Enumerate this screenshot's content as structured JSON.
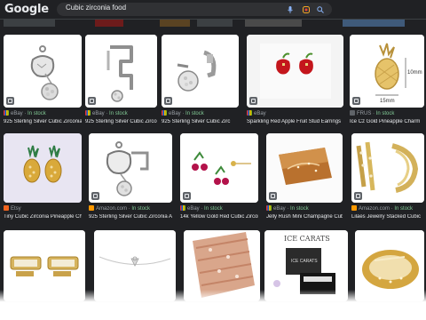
{
  "header": {
    "logo": "Google",
    "query": "Cubic zirconia food"
  },
  "icons": {
    "mic": "microphone-icon",
    "lens": "google-lens-icon",
    "search": "search-icon",
    "shopping_badge": "shopping-tag-icon"
  },
  "colors": {
    "page_bg": "#202124",
    "in_stock": "#81c995",
    "accent": "#8ab4f8"
  },
  "results": {
    "row1": [
      {
        "source": "eBay",
        "stock": "In stock",
        "title": "925 Sterling Silver Cubic Zirconia Apple"
      },
      {
        "source": "eBay",
        "stock": "In stock",
        "title": "925 Sterling Silver Cubic Zirconia Fruit"
      },
      {
        "source": "eBay",
        "stock": "In stock",
        "title": "925 Sterling Silver Cubic Zirc"
      },
      {
        "source": "eBay",
        "stock": "",
        "title": "Sparkling Red Apple Fruit Stud Earrings"
      },
      {
        "source": "FRUS",
        "stock": "In stock",
        "title": "Ice Cz Gold Pineapple Charm"
      }
    ],
    "row2": [
      {
        "source": "Etsy",
        "stock": "",
        "title": "Tiny Cubic Zirconia Pineapple Charm Gold"
      },
      {
        "source": "Amazon.com",
        "stock": "In stock",
        "title": "925 Sterling Silver Cubic Zirconia Apple Ear"
      },
      {
        "source": "eBay",
        "stock": "In stock",
        "title": "14k Yellow Gold Red Cubic Zirconia"
      },
      {
        "source": "eBay",
        "stock": "In stock",
        "title": "Jelly Rush Mini Champagne Cube"
      },
      {
        "source": "Amazon.com",
        "stock": "In stock",
        "title": "Lilaes Jewelry Stacked Cubic"
      }
    ],
    "row3": [
      {
        "alt": "gold cufflinks"
      },
      {
        "alt": "silver chain bracelet"
      },
      {
        "alt": "rose gold eternity ring"
      },
      {
        "alt": "Ice Carats jewelry box",
        "brand": "ICE CARATS",
        "box_label": "ICE CARATS"
      },
      {
        "alt": "gold bangle"
      }
    ]
  },
  "scale": {
    "height_label": "10mm",
    "width_label": "15mm"
  }
}
